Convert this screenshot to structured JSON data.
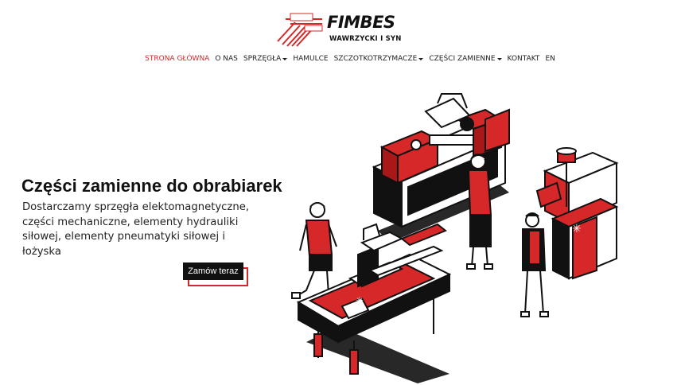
{
  "brand": {
    "name": "FIMBES",
    "subtitle": "WAWRZYCKI  I SYN"
  },
  "nav": {
    "items": [
      {
        "label": "STRONA GŁÓWNA",
        "dropdown": false,
        "active": true
      },
      {
        "label": "O NAS",
        "dropdown": false,
        "active": false
      },
      {
        "label": "SPRZĘGŁA",
        "dropdown": true,
        "active": false
      },
      {
        "label": "HAMULCE",
        "dropdown": false,
        "active": false
      },
      {
        "label": "SZCZOTKOTRZYMACZE",
        "dropdown": true,
        "active": false
      },
      {
        "label": "CZĘŚCI ZAMIENNE",
        "dropdown": true,
        "active": false
      },
      {
        "label": "KONTAKT",
        "dropdown": false,
        "active": false
      },
      {
        "label": "EN",
        "dropdown": false,
        "active": false
      }
    ]
  },
  "hero": {
    "title": "Części zamienne do obrabiarek",
    "description": "Dostarczamy sprzęgła elektomagnetyczne, części mechaniczne, elementy hydrauliki siłowej, elementy pneumatyki siłowej i łożyska",
    "cta_label": "Zamów teraz"
  },
  "colors": {
    "accent": "#d62828",
    "dark": "#111111"
  }
}
